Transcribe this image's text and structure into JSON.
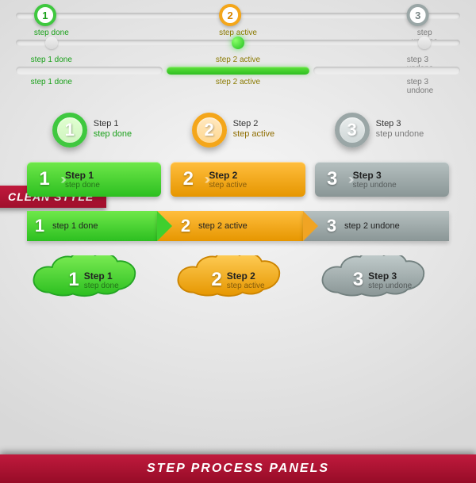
{
  "colors": {
    "green": "#3fc83f",
    "orange": "#f4a61a",
    "grey": "#9aa6a6",
    "banner": "#c01a3d"
  },
  "barA": {
    "s1": {
      "num": "1",
      "label": "step done"
    },
    "s2": {
      "num": "2",
      "label": "step active"
    },
    "s3": {
      "num": "3",
      "label": "step undone"
    }
  },
  "barB": {
    "s1": {
      "label": "step 1 done"
    },
    "s2": {
      "label": "step 2 active"
    },
    "s3": {
      "label": "step 3 undone"
    }
  },
  "barC": {
    "s1": {
      "label": "step 1 done"
    },
    "s2": {
      "label": "step 2 active"
    },
    "s3": {
      "label": "step 3 undone"
    }
  },
  "clean_banner": "CLEAN STYLE",
  "bigrow": {
    "s1": {
      "num": "1",
      "title": "Step 1",
      "sub": "step done"
    },
    "s2": {
      "num": "2",
      "title": "Step 2",
      "sub": "step active"
    },
    "s3": {
      "num": "3",
      "title": "Step 3",
      "sub": "step undone"
    }
  },
  "panels": {
    "s1": {
      "num": "1",
      "title": "Step 1",
      "sub": "step done"
    },
    "s2": {
      "num": "2",
      "title": "Step 2",
      "sub": "step active"
    },
    "s3": {
      "num": "3",
      "title": "Step 3",
      "sub": "step undone"
    }
  },
  "ribbon": {
    "s1": {
      "num": "1",
      "label": "step 1 done"
    },
    "s2": {
      "num": "2",
      "label": "step 2 active"
    },
    "s3": {
      "num": "3",
      "label": "step 2 undone"
    }
  },
  "clouds": {
    "s1": {
      "num": "1",
      "title": "Step 1",
      "sub": "step done"
    },
    "s2": {
      "num": "2",
      "title": "Step 2",
      "sub": "step active"
    },
    "s3": {
      "num": "3",
      "title": "Step 3",
      "sub": "step undone"
    }
  },
  "footer": "STEP PROCESS PANELS"
}
